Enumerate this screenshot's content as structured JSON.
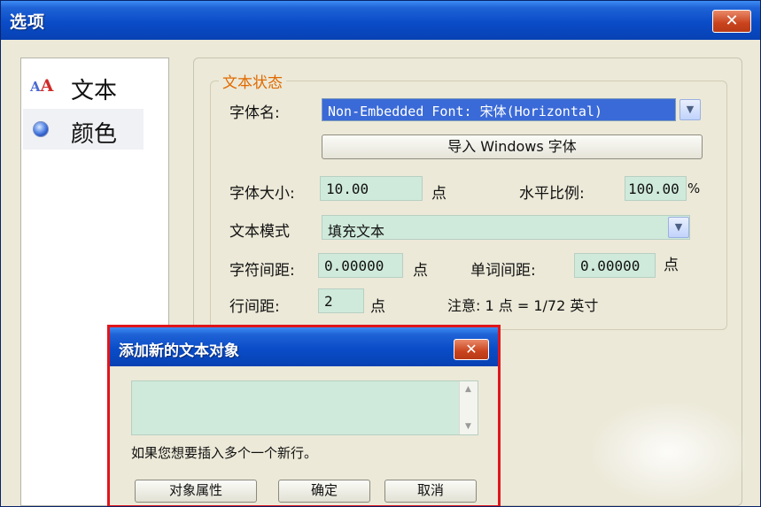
{
  "window": {
    "title": "选项",
    "close_label": "✕"
  },
  "nav": {
    "items": [
      {
        "label": "文本",
        "icon": "font-aa-icon",
        "icon_glyphs": [
          "A",
          "A"
        ]
      },
      {
        "label": "颜色",
        "icon": "radio-selected-icon"
      }
    ]
  },
  "text_state": {
    "legend": "文本状态",
    "font_name_label": "字体名:",
    "font_name_value": "Non-Embedded Font: 宋体(Horizontal)",
    "import_button": "导入 Windows 字体",
    "font_size_label": "字体大小:",
    "font_size_value": "10.00",
    "font_size_unit": "点",
    "h_scale_label": "水平比例:",
    "h_scale_value": "100.00",
    "h_scale_unit": "%",
    "text_mode_label": "文本模式",
    "text_mode_value": "填充文本",
    "char_spacing_label": "字符间距:",
    "char_spacing_value": "0.00000",
    "char_spacing_unit": "点",
    "word_spacing_label": "单词间距:",
    "word_spacing_value": "0.00000",
    "word_spacing_unit": "点",
    "line_spacing_label": "行间距:",
    "line_spacing_value": "2",
    "line_spacing_unit": "点",
    "note": "注意: 1 点 = 1/72 英寸"
  },
  "add_text_dialog": {
    "title": "添加新的文本对象",
    "close_label": "✕",
    "textarea_value": "",
    "hint": "如果您想要插入多个一个新行。",
    "buttons": {
      "properties": "对象属性",
      "ok": "确定",
      "cancel": "取消"
    }
  },
  "colors": {
    "titlebar": "#0a4cc8",
    "field_bg": "#cfeadb",
    "legend_text": "#e06a00",
    "highlight_border": "#e0161c",
    "close_button": "#c9431d"
  }
}
